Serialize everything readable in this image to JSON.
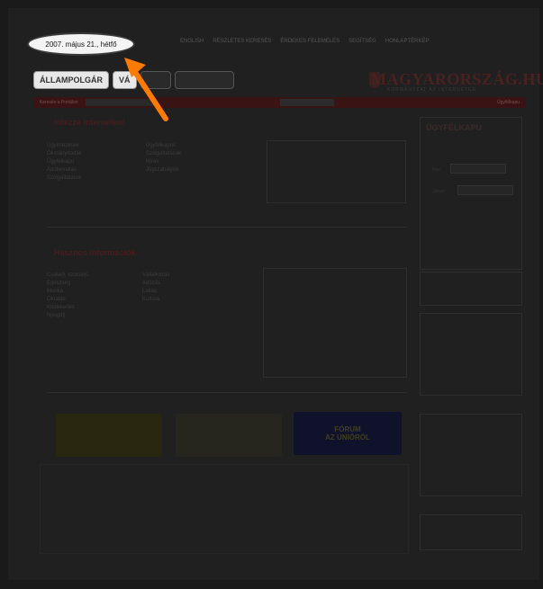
{
  "header": {
    "date": "2007. május 21., hétfő",
    "links": [
      "ENGLISH",
      "RÉSZLETES KERESÉS",
      "ÉRDEKES FELEMELÉS",
      "SEGÍTSÉG",
      "HONLAPTÉRKÉP"
    ]
  },
  "tabs": {
    "citizen": "ÁLLAMPOLGÁR",
    "company": "VÁ",
    "other1": "",
    "other2": ""
  },
  "logo": {
    "title": "MAGYARORSZÁG.HU",
    "subtitle": "KORMÁNYZAT AZ INTERNETEN"
  },
  "navbar": {
    "label": "Keresés a Portálon",
    "select_value": "Ügyintézés",
    "right_text": "Ügyfélkapu"
  },
  "main": {
    "section1_title": "Intézze interneten!",
    "col1": [
      "Ügyintézések",
      "Okmányirodák",
      "Ügyfélkapu",
      "Adóbevallás",
      "Szolgáltatások"
    ],
    "col2": [
      "Ügyfélkapus",
      "Szolgáltatások",
      "Hírek",
      "Jogszabályok"
    ],
    "section2_title": "Hasznos információk",
    "col3": [
      "Családi, szociális",
      "Egészség",
      "Munka",
      "Oktatás",
      "Közlekedés",
      "Nyugdíj"
    ],
    "col4": [
      "Vállalkozás",
      "Adózás",
      "Lakás",
      "Kultúra"
    ]
  },
  "sidebar": {
    "title": "ÜGYFÉLKAPU",
    "user_label": "Név",
    "pass_label": "Jelszó"
  },
  "banners": {
    "b1": "",
    "b2": "",
    "b3_line1": "FÓRUM",
    "b3_line2": "AZ UNIÓRÓL"
  },
  "colors": {
    "accent": "#ff7a00",
    "highlight": "#f4f4f4"
  }
}
